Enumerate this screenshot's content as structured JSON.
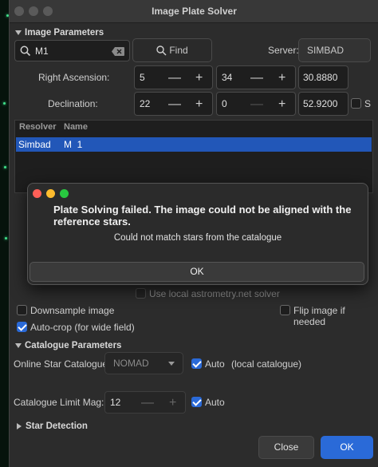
{
  "window": {
    "title": "Image Plate Solver"
  },
  "image_params": {
    "section": "Image Parameters",
    "search_value": "M1",
    "find_label": "Find",
    "server_label": "Server:",
    "server_value": "SIMBAD",
    "ra_label": "Right Ascension:",
    "ra_h": "5",
    "ra_m": "34",
    "ra_s": "30.8880",
    "dec_label": "Declination:",
    "dec_d": "22",
    "dec_m": "0",
    "dec_s": "52.9200",
    "south_label": "S"
  },
  "resolver_table": {
    "headers": [
      "Resolver",
      "Name"
    ],
    "rows": [
      {
        "resolver": "Simbad",
        "name": "M  1"
      }
    ]
  },
  "options": {
    "local_solver": "Use local astrometry.net solver",
    "downsample": "Downsample image",
    "flip": "Flip image if needed",
    "autocrop": "Auto-crop (for wide field)"
  },
  "catalogue": {
    "section": "Catalogue Parameters",
    "online_label": "Online Star Catalogue:",
    "online_value": "NOMAD",
    "auto1": "Auto",
    "local_note": "(local catalogue)",
    "limit_label": "Catalogue Limit Mag:",
    "limit_value": "12",
    "auto2": "Auto"
  },
  "star_detection": {
    "section": "Star Detection"
  },
  "buttons": {
    "close": "Close",
    "ok": "OK"
  },
  "dialog": {
    "title": "Plate Solving failed. The image could not be aligned with the reference stars.",
    "message": "Could not match stars from the catalogue",
    "ok": "OK"
  },
  "colors": {
    "accent": "#2a6ad8",
    "selection": "#2257b8",
    "ok_button": "#2a6ad8"
  }
}
